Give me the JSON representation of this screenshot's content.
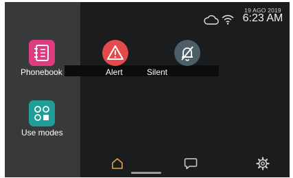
{
  "status_bar": {
    "date": "19 AGO 2019",
    "time": "6:23 AM",
    "icons": [
      "cloud-icon",
      "wifi-icon"
    ]
  },
  "apps": [
    {
      "id": "phonebook",
      "label": "Phonebook",
      "icon": "phonebook-icon",
      "color": "#dd3d80"
    },
    {
      "id": "alert",
      "label": "Alert",
      "icon": "warning-triangle-icon",
      "color": "#e34a4c"
    },
    {
      "id": "silent",
      "label": "Silent",
      "icon": "muted-bell-icon",
      "color": "#4c5e68"
    },
    {
      "id": "use_modes",
      "label": "Use modes",
      "icon": "modes-grid-icon",
      "color": "#1f9e97"
    }
  ],
  "nav": {
    "items": [
      "home-icon",
      "chat-icon",
      "settings-gear-icon"
    ],
    "active_item": "home-icon",
    "active_color": "#e8a24a"
  }
}
